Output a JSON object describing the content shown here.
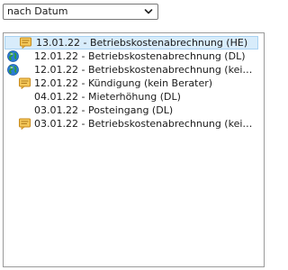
{
  "sort_select": {
    "value": "nach Datum"
  },
  "entries": [
    {
      "date": "13.01.22",
      "text": "13.01.22 - Betriebskostenabrechnung (HE)",
      "icon": "note-icon",
      "selected": true
    },
    {
      "date": "12.01.22",
      "text": "12.01.22 - Betriebskostenabrechnung (DL)",
      "icon": "globe-icon",
      "selected": false
    },
    {
      "date": "12.01.22",
      "text": "12.01.22 - Betriebskostenabrechnung (kei…",
      "icon": "globe-icon",
      "selected": false
    },
    {
      "date": "12.01.22",
      "text": "12.01.22 - Kündigung (kein Berater)",
      "icon": "note-icon",
      "selected": false
    },
    {
      "date": "04.01.22",
      "text": "04.01.22 - Mieterhöhung (DL)",
      "icon": "",
      "selected": false
    },
    {
      "date": "03.01.22",
      "text": "03.01.22 - Posteingang (DL)",
      "icon": "",
      "selected": false
    },
    {
      "date": "03.01.22",
      "text": "03.01.22 - Betriebskostenabrechnung (kei…",
      "icon": "note-icon",
      "selected": false
    }
  ],
  "colors": {
    "selection_bg": "#d8ecfb",
    "selection_border": "#a9d2f2",
    "note_icon": "#e8b13a",
    "globe_icon": "#2b7bd6"
  }
}
